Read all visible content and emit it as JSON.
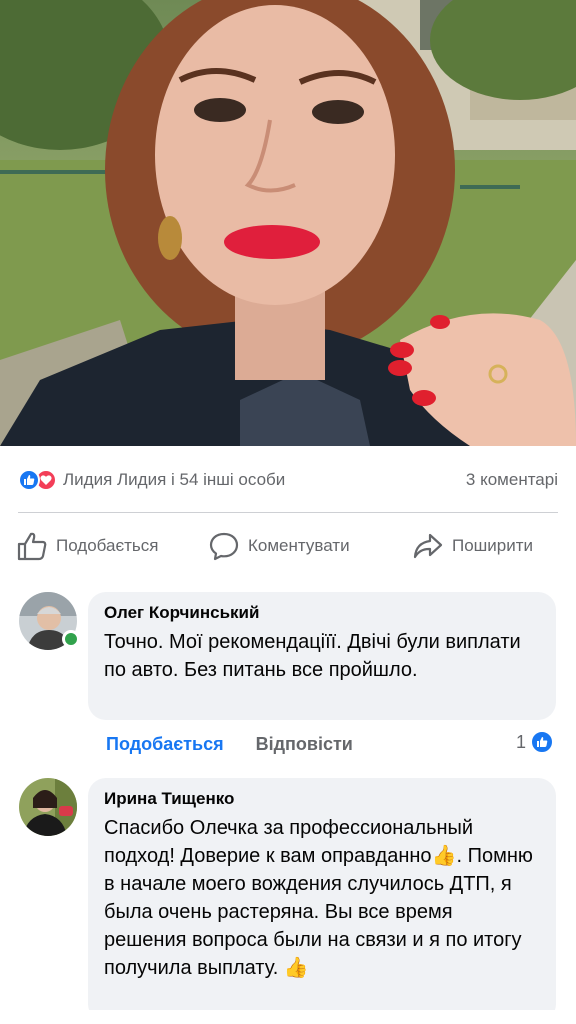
{
  "post": {
    "reactions": {
      "icons": [
        "like-reaction-icon",
        "love-reaction-icon"
      ],
      "reactors_text": "Лидия Лидия і 54 інші особи",
      "comments_count_text": "3 коментарі"
    },
    "actions": {
      "like": "Подобається",
      "comment": "Коментувати",
      "share": "Поширити"
    }
  },
  "comments": [
    {
      "author": "Олег Корчинський",
      "text": "Точно. Мої рекомендаціїї. Двічі були виплати по авто. Без питань  все пройшло.",
      "like_label": "Подобається",
      "reply_label": "Відповісти",
      "likes": "1",
      "online": true
    },
    {
      "author": "Ирина Тищенко",
      "text": "Спасибо Олечка за профессиональный подход! Доверие к вам оправданно👍. Помню в начале моего вождения случилось ДТП, я была очень растеряна. Вы все время решения вопроса были на связи и я по итогу  получила выплату. 👍"
    }
  ],
  "colors": {
    "accent": "#1877f2",
    "love": "#f33e58",
    "bubble": "#f0f2f5",
    "secondary_text": "#65676b",
    "online": "#31a24c"
  }
}
